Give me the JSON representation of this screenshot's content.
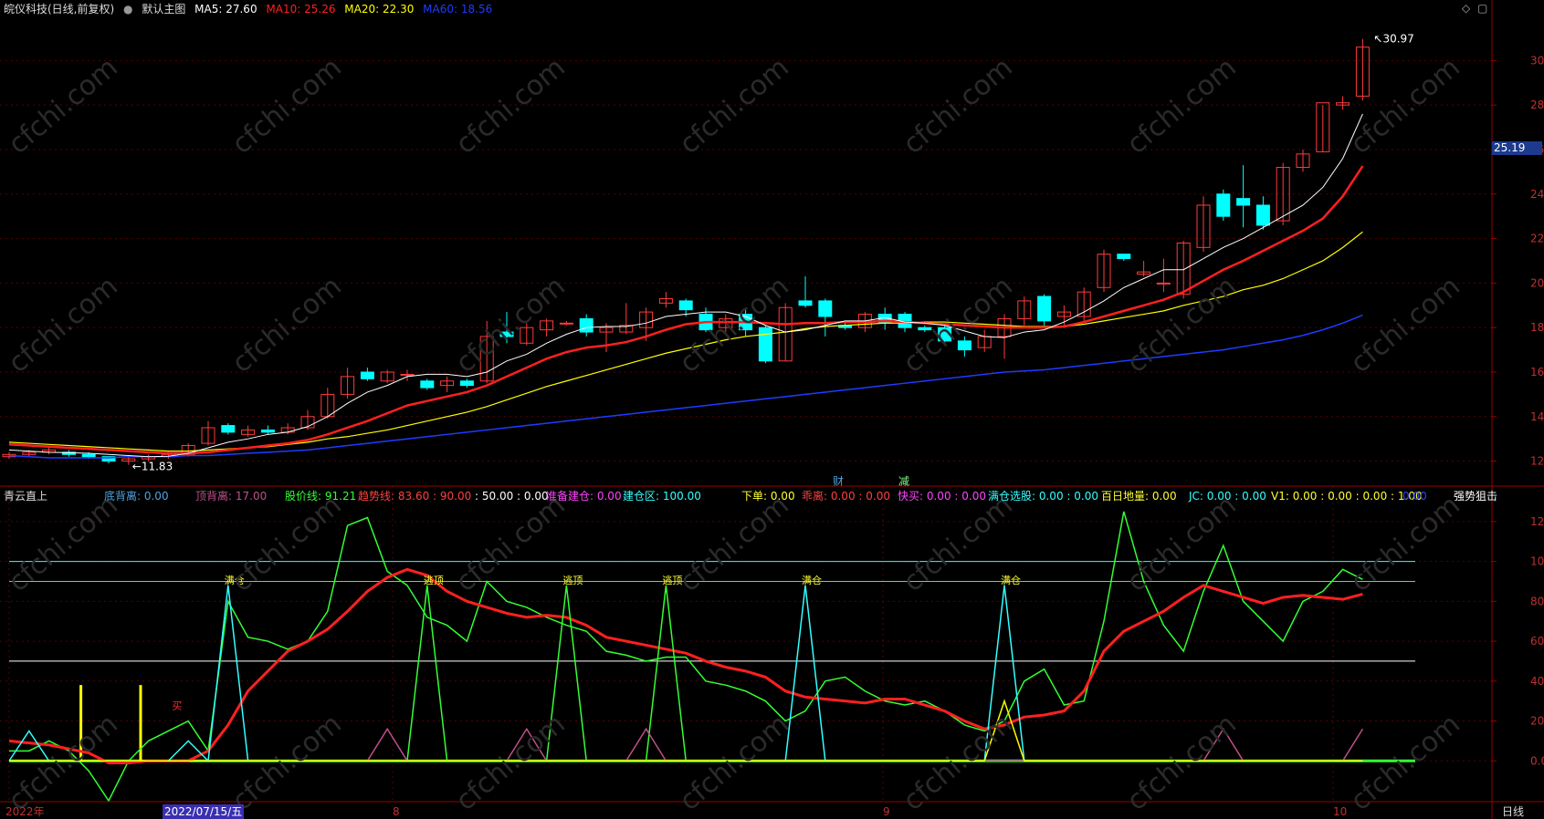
{
  "main_header": {
    "stock": "皖仪科技(日线,前复权)",
    "template": "默认主图",
    "ma5": "MA5: 27.60",
    "ma10": "MA10: 25.26",
    "ma20": "MA20: 22.30",
    "ma60": "MA60: 18.56"
  },
  "colors": {
    "ma5": "#ffffff",
    "ma10": "#ff2020",
    "ma20": "#ffff00",
    "ma60": "#1e3cff",
    "up": "#ff3b3b",
    "down": "#00ffff",
    "grid": "#5a0000",
    "axis": "#9b0000"
  },
  "markers": {
    "high_label": "30.97",
    "low_label": "11.83",
    "current_price": "25.19",
    "event_cai": "财",
    "event_jian": "减"
  },
  "sub_header": {
    "name": "青云直上",
    "items": [
      {
        "text": "底背离: 0.00",
        "color": "#4fa3e0"
      },
      {
        "text": "顶背离: 17.00",
        "color": "#c0508a"
      },
      {
        "text": "股价线: 91.21",
        "color": "#33ff33"
      },
      {
        "text": "趋势线: 83.60 : 90.00",
        "color": "#ff4040"
      },
      {
        "text": ": 50.00 : 0.00",
        "color": "#ffffff"
      },
      {
        "text": "准备建仓: 0.00",
        "color": "#ff44ff"
      },
      {
        "text": "建仓区: 100.00",
        "color": "#33ffff"
      },
      {
        "text": "下单: 0.00",
        "color": "#ffff33"
      },
      {
        "text": "乖离: 0.00 : 0.00",
        "color": "#ff4040"
      },
      {
        "text": "快买: 0.00 : 0.00",
        "color": "#ff44ff"
      },
      {
        "text": "满仓选股: 0.00 : 0.00",
        "color": "#33ffff"
      },
      {
        "text": "百日地量: 0.00",
        "color": "#ffff33"
      },
      {
        "text": "JC: 0.00 : 0.00",
        "color": "#33ffff"
      },
      {
        "text": "V1: 0.00 : 0.00 : 0.00 : 1.00",
        "color": "#ffff33"
      },
      {
        "text": "0.00",
        "color": "#3344ff"
      },
      {
        "text": "强势狙击",
        "color": "#ffffff"
      }
    ]
  },
  "sub_labels": {
    "full": "满仓",
    "top": "逃顶",
    "buy": "买"
  },
  "x_axis": {
    "labels": [
      "2022年",
      "2022/07/15/五",
      "8",
      "9",
      "10"
    ],
    "period": "日线"
  },
  "chart_data": [
    {
      "type": "candlestick",
      "title": "皖仪科技(日线,前复权)",
      "ylim": [
        11.0,
        31.9
      ],
      "yticks": [
        12.0,
        14.0,
        16.0,
        18.0,
        20.0,
        22.0,
        24.0,
        26.0,
        28.0,
        30.0
      ],
      "candles": [
        [
          12.2,
          12.3,
          12.1,
          12.4
        ],
        [
          12.3,
          12.4,
          12.2,
          12.5
        ],
        [
          12.4,
          12.5,
          12.3,
          12.6
        ],
        [
          12.4,
          12.3,
          12.2,
          12.5
        ],
        [
          12.3,
          12.2,
          12.1,
          12.4
        ],
        [
          12.2,
          12.0,
          11.9,
          12.2
        ],
        [
          12.0,
          12.1,
          11.83,
          12.2
        ],
        [
          12.1,
          12.2,
          12.0,
          12.3
        ],
        [
          12.2,
          12.3,
          12.1,
          12.4
        ],
        [
          12.3,
          12.7,
          12.2,
          12.8
        ],
        [
          12.8,
          13.5,
          12.7,
          13.8
        ],
        [
          13.6,
          13.3,
          13.2,
          13.7
        ],
        [
          13.2,
          13.4,
          13.1,
          13.6
        ],
        [
          13.4,
          13.3,
          13.2,
          13.6
        ],
        [
          13.3,
          13.5,
          13.2,
          13.7
        ],
        [
          13.5,
          14.0,
          13.4,
          14.3
        ],
        [
          14.0,
          15.0,
          13.9,
          15.3
        ],
        [
          15.0,
          15.8,
          14.8,
          16.2
        ],
        [
          16.0,
          15.7,
          15.6,
          16.2
        ],
        [
          15.6,
          16.0,
          15.5,
          16.1
        ],
        [
          15.9,
          15.9,
          15.6,
          16.1
        ],
        [
          15.6,
          15.3,
          15.2,
          15.7
        ],
        [
          15.4,
          15.6,
          15.1,
          15.8
        ],
        [
          15.6,
          15.4,
          15.3,
          15.7
        ],
        [
          15.6,
          17.6,
          15.5,
          18.3
        ],
        [
          17.8,
          17.6,
          17.3,
          18.7
        ],
        [
          17.3,
          18.0,
          17.2,
          18.2
        ],
        [
          17.9,
          18.3,
          17.6,
          18.4
        ],
        [
          18.2,
          18.2,
          18.1,
          18.3
        ],
        [
          18.4,
          17.8,
          17.6,
          18.6
        ],
        [
          17.8,
          18.0,
          16.9,
          18.2
        ],
        [
          17.8,
          18.1,
          17.7,
          19.1
        ],
        [
          18.0,
          18.7,
          17.4,
          18.9
        ],
        [
          19.1,
          19.3,
          18.9,
          19.6
        ],
        [
          19.2,
          18.8,
          18.5,
          19.3
        ],
        [
          18.6,
          17.9,
          17.8,
          18.9
        ],
        [
          18.0,
          18.4,
          17.8,
          18.6
        ],
        [
          18.6,
          17.9,
          17.6,
          18.8
        ],
        [
          18.0,
          16.5,
          16.4,
          18.1
        ],
        [
          16.5,
          18.9,
          16.5,
          19.1
        ],
        [
          19.2,
          19.0,
          18.9,
          20.3
        ],
        [
          19.2,
          18.5,
          17.6,
          19.3
        ],
        [
          18.1,
          18.0,
          17.9,
          18.3
        ],
        [
          18.0,
          18.6,
          17.8,
          18.7
        ],
        [
          18.6,
          18.2,
          17.9,
          18.9
        ],
        [
          18.6,
          18.0,
          17.8,
          18.7
        ],
        [
          18.0,
          17.9,
          17.8,
          18.1
        ],
        [
          18.0,
          17.4,
          17.3,
          18.1
        ],
        [
          17.4,
          17.0,
          16.7,
          17.6
        ],
        [
          17.1,
          17.6,
          16.9,
          17.9
        ],
        [
          17.6,
          18.4,
          16.6,
          18.6
        ],
        [
          18.4,
          19.2,
          18.1,
          19.4
        ],
        [
          19.4,
          18.3,
          18.1,
          19.5
        ],
        [
          18.5,
          18.7,
          18.0,
          19.0
        ],
        [
          18.5,
          19.6,
          18.3,
          19.8
        ],
        [
          19.8,
          21.3,
          19.6,
          21.5
        ],
        [
          21.3,
          21.1,
          21.0,
          21.3
        ],
        [
          20.4,
          20.5,
          20.3,
          21.0
        ],
        [
          20.0,
          20.0,
          19.6,
          21.1
        ],
        [
          19.5,
          21.8,
          19.3,
          21.9
        ],
        [
          21.6,
          23.5,
          21.4,
          23.9
        ],
        [
          24.0,
          23.0,
          22.8,
          24.2
        ],
        [
          23.8,
          23.5,
          22.5,
          25.3
        ],
        [
          23.5,
          22.6,
          22.4,
          23.9
        ],
        [
          22.8,
          25.2,
          22.6,
          25.4
        ],
        [
          25.2,
          25.8,
          25.0,
          26.0
        ],
        [
          25.9,
          28.1,
          25.9,
          28.0
        ],
        [
          28.0,
          28.1,
          27.8,
          28.4
        ],
        [
          28.4,
          30.6,
          28.2,
          30.97
        ]
      ],
      "ma5": [
        12.5,
        12.45,
        12.4,
        12.38,
        12.35,
        12.3,
        12.25,
        12.2,
        12.22,
        12.35,
        12.6,
        12.85,
        13.0,
        13.2,
        13.3,
        13.55,
        14.0,
        14.6,
        15.1,
        15.4,
        15.8,
        15.9,
        15.9,
        15.8,
        16.0,
        16.5,
        16.8,
        17.3,
        17.7,
        18.0,
        18.05,
        18.05,
        18.2,
        18.5,
        18.6,
        18.7,
        18.7,
        18.5,
        18.1,
        17.8,
        17.9,
        18.1,
        18.3,
        18.3,
        18.45,
        18.25,
        18.2,
        18.1,
        17.85,
        17.6,
        17.55,
        17.8,
        17.9,
        18.25,
        18.7,
        19.2,
        19.8,
        20.2,
        20.6,
        20.6,
        21.1,
        21.6,
        22.0,
        22.5,
        23.0,
        23.5,
        24.3,
        25.6,
        27.6
      ],
      "ma10": [
        12.75,
        12.7,
        12.65,
        12.6,
        12.55,
        12.5,
        12.45,
        12.4,
        12.35,
        12.35,
        12.4,
        12.5,
        12.6,
        12.7,
        12.8,
        12.95,
        13.2,
        13.5,
        13.8,
        14.15,
        14.5,
        14.7,
        14.9,
        15.1,
        15.4,
        15.8,
        16.2,
        16.6,
        16.9,
        17.1,
        17.2,
        17.35,
        17.6,
        17.9,
        18.15,
        18.25,
        18.25,
        18.25,
        18.2,
        18.15,
        18.2,
        18.2,
        18.25,
        18.25,
        18.3,
        18.25,
        18.2,
        18.15,
        18.1,
        18.05,
        18.0,
        18.0,
        18.0,
        18.05,
        18.25,
        18.5,
        18.75,
        19.0,
        19.25,
        19.6,
        20.1,
        20.6,
        21.0,
        21.45,
        21.9,
        22.35,
        22.9,
        23.9,
        25.26
      ],
      "ma20": [
        12.85,
        12.8,
        12.75,
        12.7,
        12.65,
        12.6,
        12.55,
        12.5,
        12.45,
        12.45,
        12.5,
        12.55,
        12.6,
        12.65,
        12.75,
        12.85,
        13.0,
        13.1,
        13.25,
        13.4,
        13.6,
        13.8,
        14.0,
        14.2,
        14.45,
        14.75,
        15.05,
        15.35,
        15.6,
        15.85,
        16.1,
        16.35,
        16.6,
        16.85,
        17.05,
        17.25,
        17.45,
        17.6,
        17.7,
        17.8,
        17.95,
        18.05,
        18.1,
        18.15,
        18.2,
        18.2,
        18.25,
        18.25,
        18.2,
        18.15,
        18.1,
        18.05,
        18.05,
        18.05,
        18.15,
        18.3,
        18.45,
        18.6,
        18.75,
        19.0,
        19.2,
        19.4,
        19.7,
        19.9,
        20.2,
        20.6,
        21.0,
        21.6,
        22.3
      ],
      "ma60": [
        12.25,
        12.2,
        12.15,
        12.15,
        12.15,
        12.15,
        12.2,
        12.2,
        12.2,
        12.25,
        12.25,
        12.3,
        12.35,
        12.4,
        12.45,
        12.5,
        12.6,
        12.7,
        12.8,
        12.9,
        13.0,
        13.1,
        13.2,
        13.3,
        13.4,
        13.5,
        13.6,
        13.7,
        13.8,
        13.9,
        14.0,
        14.1,
        14.2,
        14.3,
        14.4,
        14.5,
        14.6,
        14.7,
        14.8,
        14.9,
        15.0,
        15.1,
        15.2,
        15.3,
        15.4,
        15.5,
        15.6,
        15.7,
        15.8,
        15.9,
        16.0,
        16.05,
        16.1,
        16.2,
        16.3,
        16.4,
        16.5,
        16.6,
        16.7,
        16.8,
        16.9,
        17.0,
        17.15,
        17.3,
        17.45,
        17.65,
        17.9,
        18.2,
        18.56
      ]
    },
    {
      "type": "line",
      "title": "青云直上",
      "ylim": [
        -20,
        130
      ],
      "yticks": [
        0.0,
        20.0,
        40.0,
        60.0,
        80.0,
        100.0,
        120.0
      ],
      "hlines": [
        {
          "y": 100,
          "color": "#33ffff"
        },
        {
          "y": 90,
          "color": "#33ff33"
        },
        {
          "y": 50,
          "color": "#ffffff"
        }
      ],
      "series": [
        {
          "name": "股价线",
          "color": "#33ff33",
          "values": [
            5,
            5,
            10,
            5,
            -5,
            -20,
            0,
            10,
            15,
            20,
            5,
            80,
            62,
            60,
            56,
            60,
            75,
            118,
            122,
            95,
            88,
            72,
            68,
            60,
            90,
            80,
            77,
            72,
            68,
            65,
            55,
            53,
            50,
            52,
            52,
            40,
            38,
            35,
            30,
            20,
            25,
            40,
            42,
            35,
            30,
            28,
            30,
            25,
            18,
            15,
            20,
            40,
            46,
            28,
            30,
            70,
            125,
            90,
            68,
            55,
            85,
            108,
            80,
            70,
            60,
            80,
            85,
            96,
            91
          ]
        },
        {
          "name": "趋势线",
          "color": "#ff2020",
          "values": [
            10,
            9,
            8,
            6,
            4,
            -1,
            -1,
            0,
            0,
            0,
            5,
            18,
            35,
            45,
            55,
            60,
            66,
            75,
            85,
            92,
            96,
            93,
            85,
            80,
            77,
            74,
            72,
            73,
            72,
            68,
            62,
            60,
            58,
            56,
            54,
            50,
            47,
            45,
            42,
            35,
            32,
            31,
            30,
            29,
            31,
            31,
            28,
            25,
            20,
            16,
            18,
            22,
            23,
            25,
            35,
            55,
            65,
            70,
            75,
            82,
            88,
            85,
            82,
            79,
            82,
            83,
            82,
            81,
            83.6
          ]
        },
        {
          "name": "满仓",
          "color": "#33ffff",
          "values": [
            0,
            15,
            0,
            0,
            0,
            0,
            0,
            0,
            0,
            10,
            0,
            88,
            0,
            0,
            0,
            0,
            0,
            0,
            0,
            0,
            0,
            0,
            0,
            0,
            0,
            0,
            0,
            0,
            0,
            0,
            0,
            0,
            0,
            0,
            0,
            0,
            0,
            0,
            0,
            0,
            88,
            0,
            0,
            0,
            0,
            0,
            0,
            0,
            0,
            0,
            88,
            0,
            0,
            0,
            0,
            0,
            0,
            0,
            0,
            0,
            0,
            0,
            0,
            0,
            0,
            0,
            0,
            0,
            0
          ]
        },
        {
          "name": "逃顶",
          "color": "#33ff33",
          "values": [
            0,
            0,
            0,
            0,
            0,
            0,
            0,
            0,
            0,
            0,
            0,
            0,
            0,
            0,
            0,
            0,
            0,
            0,
            0,
            0,
            0,
            88,
            0,
            0,
            0,
            0,
            0,
            0,
            88,
            0,
            0,
            0,
            0,
            88,
            0,
            0,
            0,
            0,
            0,
            0,
            0,
            0,
            0,
            0,
            0,
            0,
            0,
            0,
            0,
            0,
            0,
            0,
            0,
            0,
            0,
            0,
            0,
            0,
            0,
            0,
            0,
            0,
            0,
            0,
            0,
            0,
            0,
            0,
            0
          ]
        },
        {
          "name": "顶背离",
          "color": "#c0508a",
          "values": [
            0,
            0,
            0,
            0,
            0,
            0,
            0,
            0,
            0,
            0,
            0,
            0,
            0,
            0,
            0,
            0,
            0,
            0,
            0,
            16,
            0,
            0,
            0,
            0,
            0,
            0,
            16,
            0,
            0,
            0,
            0,
            0,
            16,
            0,
            0,
            0,
            0,
            0,
            0,
            0,
            0,
            0,
            0,
            0,
            0,
            0,
            0,
            0,
            0,
            0,
            0,
            0,
            0,
            0,
            0,
            0,
            0,
            0,
            0,
            0,
            0,
            16,
            0,
            0,
            0,
            0,
            0,
            0,
            16
          ]
        },
        {
          "name": "买",
          "color": "#ffff00",
          "values": [
            0,
            0,
            0,
            0,
            0,
            0,
            0,
            0,
            0,
            0,
            0,
            0,
            0,
            0,
            0,
            0,
            0,
            0,
            0,
            0,
            0,
            0,
            0,
            0,
            0,
            0,
            0,
            0,
            0,
            0,
            0,
            0,
            0,
            0,
            0,
            0,
            0,
            0,
            0,
            0,
            0,
            0,
            0,
            0,
            0,
            0,
            0,
            0,
            0,
            0,
            30,
            0,
            0,
            0,
            0,
            0,
            0,
            0,
            0,
            0,
            0,
            0,
            0,
            0,
            0,
            0,
            0,
            0,
            0
          ]
        }
      ],
      "bars": [
        {
          "index": 2,
          "value": 38,
          "color": "#ffff00"
        },
        {
          "index": 5,
          "value": 38,
          "color": "#ffff00"
        }
      ]
    }
  ]
}
